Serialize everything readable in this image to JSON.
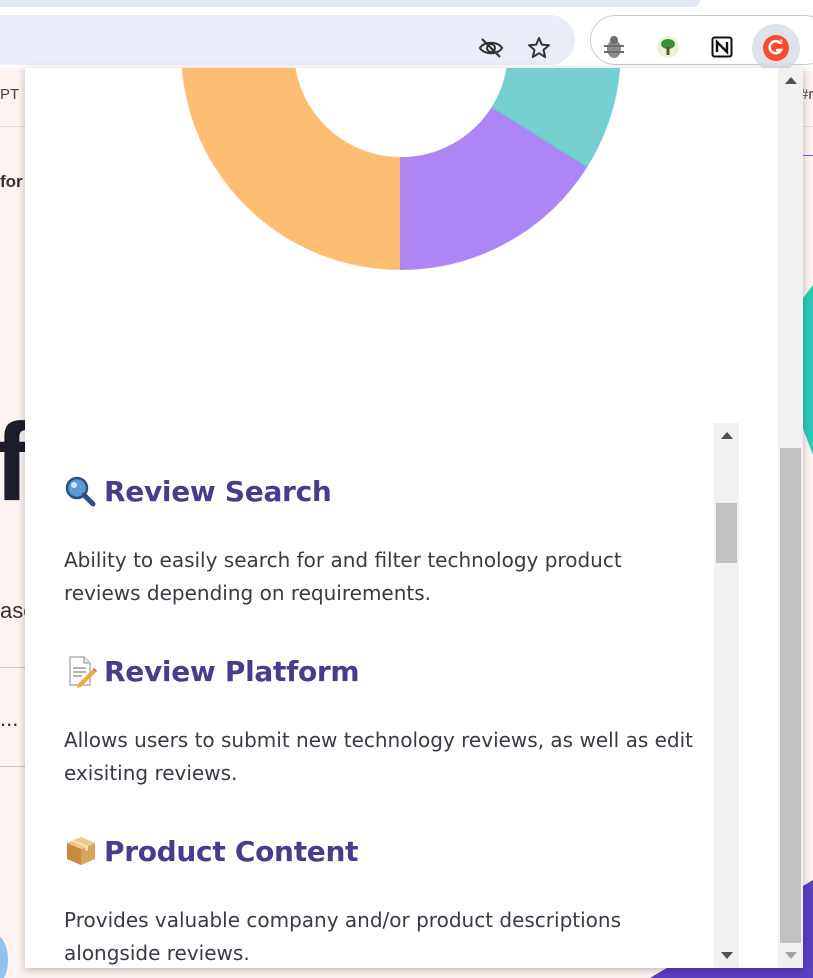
{
  "browser": {
    "extensions": [
      {
        "name": "bug-extension-icon"
      },
      {
        "name": "tree-extension-icon"
      },
      {
        "name": "notion-extension-icon"
      },
      {
        "name": "g2-extension-icon"
      }
    ]
  },
  "background_page": {
    "bookmark_left": "PT",
    "bookmark_right": "#r",
    "heading_fragment": "for",
    "big_text_fragment": "fc",
    "body_fragment": "ase",
    "ellipsis": "..."
  },
  "popup": {
    "chart_data": {
      "type": "pie",
      "variant": "donut",
      "note": "partial view, top portion cropped",
      "slices": [
        {
          "color": "#fdba6b",
          "label": ""
        },
        {
          "color": "#a97ff5",
          "label": ""
        },
        {
          "color": "#6ecdcc",
          "label": ""
        },
        {
          "color": "#fca3a3",
          "label": ""
        },
        {
          "color": "#fdd87a",
          "label": ""
        }
      ]
    },
    "features": [
      {
        "icon": "magnifying-glass-icon",
        "title": "Review Search",
        "description": "Ability to easily search for and filter technology product reviews depending on requirements."
      },
      {
        "icon": "memo-pencil-icon",
        "title": "Review Platform",
        "description": "Allows users to submit new technology reviews, as well as edit exisiting reviews."
      },
      {
        "icon": "package-icon",
        "title": "Product Content",
        "description": "Provides valuable company and/or product descriptions alongside reviews."
      }
    ]
  },
  "colors": {
    "heading": "#4a3b8d",
    "text": "#3a3a44",
    "g2_brand": "#ff492c"
  }
}
